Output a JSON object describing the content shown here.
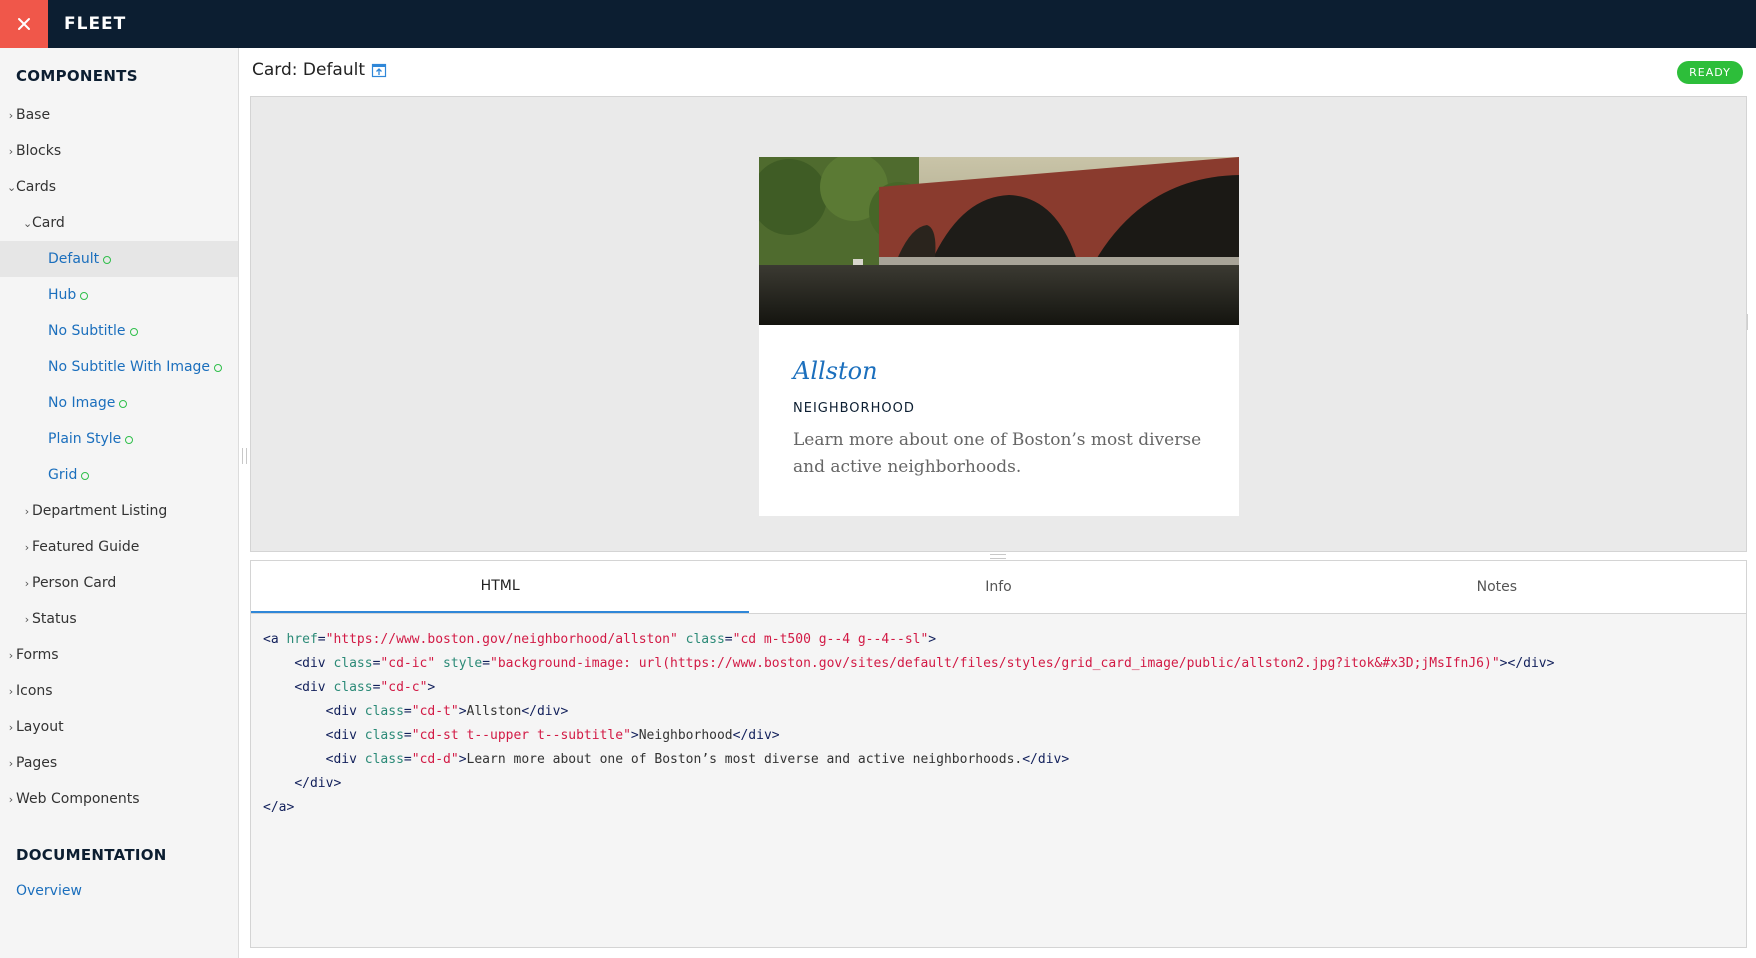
{
  "header": {
    "brand": "FLEET",
    "close_icon": "close-icon"
  },
  "sidebar": {
    "components_heading": "COMPONENTS",
    "items": [
      {
        "label": "Base",
        "level": 0,
        "chevron": "›"
      },
      {
        "label": "Blocks",
        "level": 0,
        "chevron": "›"
      },
      {
        "label": "Cards",
        "level": 0,
        "chevron": "⌄"
      },
      {
        "label": "Card",
        "level": 1,
        "chevron": "⌄"
      },
      {
        "label": "Default",
        "level": 2,
        "active": true
      },
      {
        "label": "Hub",
        "level": 2
      },
      {
        "label": "No Subtitle",
        "level": 2
      },
      {
        "label": "No Subtitle With Image",
        "level": 2
      },
      {
        "label": "No Image",
        "level": 2
      },
      {
        "label": "Plain Style",
        "level": 2
      },
      {
        "label": "Grid",
        "level": 2
      },
      {
        "label": "Department Listing",
        "level": 1,
        "chevron": "›"
      },
      {
        "label": "Featured Guide",
        "level": 1,
        "chevron": "›"
      },
      {
        "label": "Person Card",
        "level": 1,
        "chevron": "›"
      },
      {
        "label": "Status",
        "level": 1,
        "chevron": "›"
      },
      {
        "label": "Forms",
        "level": 0,
        "chevron": "›"
      },
      {
        "label": "Icons",
        "level": 0,
        "chevron": "›"
      },
      {
        "label": "Layout",
        "level": 0,
        "chevron": "›"
      },
      {
        "label": "Pages",
        "level": 0,
        "chevron": "›"
      },
      {
        "label": "Web Components",
        "level": 0,
        "chevron": "›"
      }
    ],
    "documentation_heading": "DOCUMENTATION",
    "documentation_link": "Overview"
  },
  "main": {
    "title": "Card: Default",
    "status_badge": "READY"
  },
  "preview": {
    "card": {
      "title": "Allston",
      "subtitle": "Neighborhood",
      "description": "Learn more about one of Boston’s most diverse and active neighborhoods."
    }
  },
  "tabs": [
    "HTML",
    "Info",
    "Notes"
  ],
  "active_tab": "HTML",
  "code": {
    "href": "https://www.boston.gov/neighborhood/allston",
    "class_a": "cd m-t500 g--4 g--4--sl",
    "class_ic": "cd-ic",
    "style_ic": "background-image: url(https://www.boston.gov/sites/default/files/styles/grid_card_image/public/allston2.jpg?itok&#x3D;jMsIfnJ6)",
    "class_c": "cd-c",
    "class_t": "cd-t",
    "text_t": "Allston",
    "class_st": "cd-st t--upper t--subtitle",
    "text_st": "Neighborhood",
    "class_d": "cd-d",
    "text_d": "Learn more about one of Boston’s most diverse and active neighborhoods."
  },
  "colors": {
    "header_bg": "#0c1e31",
    "close_bg": "#f0574a",
    "link": "#1b6fbd",
    "ready": "#2dbe3a",
    "tab_active": "#2f87d8"
  }
}
